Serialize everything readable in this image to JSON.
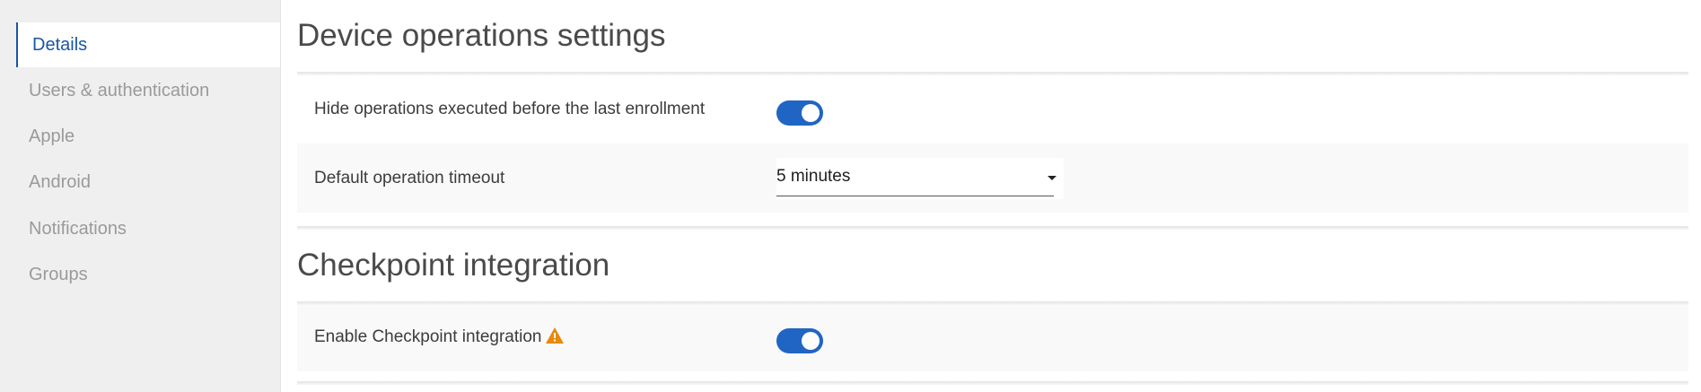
{
  "sidebar": {
    "items": [
      {
        "label": "Details",
        "active": true
      },
      {
        "label": "Users & authentication",
        "active": false
      },
      {
        "label": "Apple",
        "active": false
      },
      {
        "label": "Android",
        "active": false
      },
      {
        "label": "Notifications",
        "active": false
      },
      {
        "label": "Groups",
        "active": false
      }
    ]
  },
  "sections": {
    "device_operations": {
      "title": "Device operations settings",
      "hide_operations": {
        "label": "Hide operations executed before the last enrollment",
        "enabled": true
      },
      "default_timeout": {
        "label": "Default operation timeout",
        "value": "5 minutes"
      }
    },
    "checkpoint": {
      "title": "Checkpoint integration",
      "enable": {
        "label": "Enable Checkpoint integration",
        "enabled": true,
        "icon": "warning-icon"
      }
    }
  },
  "colors": {
    "accent": "#2165c4",
    "active_nav": "#1a56a5",
    "warning": "#e8890c",
    "sidebar_bg": "#efefef",
    "row_alt_bg": "#f9f9f9"
  }
}
